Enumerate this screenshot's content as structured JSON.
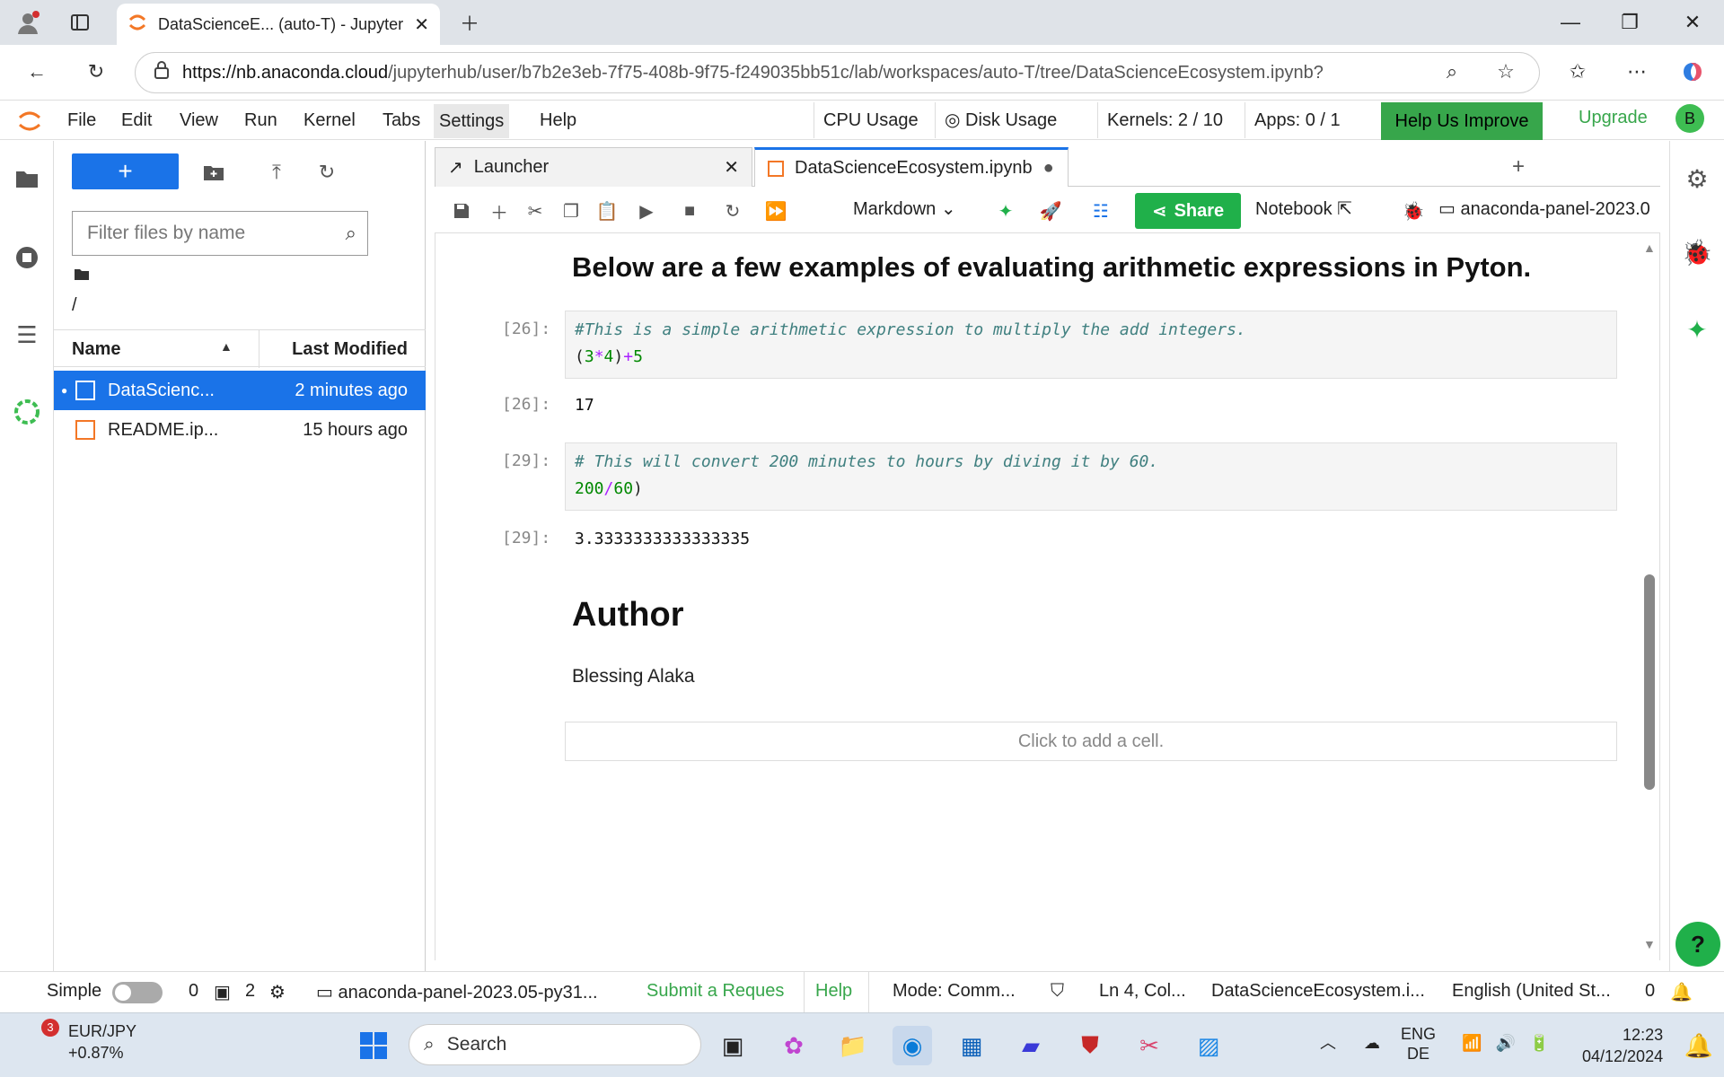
{
  "browser": {
    "tab_title": "DataScienceE... (auto-T) - Jupyter",
    "url_host": "https://nb.anaconda.cloud",
    "url_path": "/jupyterhub/user/b7b2e3eb-7f75-408b-9f75-f249035bb51c/lab/workspaces/auto-T/tree/DataScienceEcosystem.ipynb?"
  },
  "menubar": {
    "items": [
      "File",
      "Edit",
      "View",
      "Run",
      "Kernel",
      "Tabs",
      "Settings",
      "Help"
    ],
    "cpu": "CPU Usage",
    "disk": "Disk Usage",
    "kernels": "Kernels: 2 / 10",
    "apps": "Apps: 0 / 1",
    "help_improve": "Help Us Improve",
    "upgrade": "Upgrade",
    "avatar": "B"
  },
  "filebrowser": {
    "filter_placeholder": "Filter files by name",
    "path": "/",
    "col_name": "Name",
    "col_modified": "Last Modified",
    "files": [
      {
        "name": "DataScienc...",
        "modified": "2 minutes ago"
      },
      {
        "name": "README.ip...",
        "modified": "15 hours ago"
      }
    ]
  },
  "tabs": {
    "launcher": "Launcher",
    "notebook": "DataScienceEcosystem.ipynb"
  },
  "toolbar": {
    "cell_type": "Markdown",
    "share": "Share",
    "notebook": "Notebook",
    "kernel": "anaconda-panel-2023.0"
  },
  "notebook": {
    "heading": "Below are a few examples of evaluating arithmetic expressions in Pyton.",
    "cell1": {
      "prompt_in": "[26]:",
      "comment": "#This is a simple arithmetic expression to multiply the add integers.",
      "code_parts": [
        "(",
        "3",
        "*",
        "4",
        ")",
        "+",
        "5"
      ],
      "prompt_out": "[26]:",
      "output": "17"
    },
    "cell2": {
      "prompt_in": "[29]:",
      "comment": "# This will convert 200 minutes to hours by diving it by 60.",
      "code_parts": [
        "200",
        "/",
        "60",
        ")"
      ],
      "prompt_out": "[29]:",
      "output": "3.3333333333333335"
    },
    "author_heading": "Author",
    "author_name": "Blessing Alaka",
    "add_cell": "Click to add a cell."
  },
  "statusbar": {
    "simple": "Simple",
    "terminals": "0",
    "kernels_count": "2",
    "kernel_name": "anaconda-panel-2023.05-py31...",
    "submit": "Submit a Reques",
    "help": "Help",
    "mode": "Mode: Comm...",
    "position": "Ln 4, Col...",
    "file": "DataScienceEcosystem.i...",
    "language": "English (United St...",
    "notifications": "0"
  },
  "taskbar": {
    "weather_badge": "3",
    "ticker": "EUR/JPY",
    "change": "+0.87%",
    "search": "Search",
    "lang1": "ENG",
    "lang2": "DE",
    "time": "12:23",
    "date": "04/12/2024"
  }
}
